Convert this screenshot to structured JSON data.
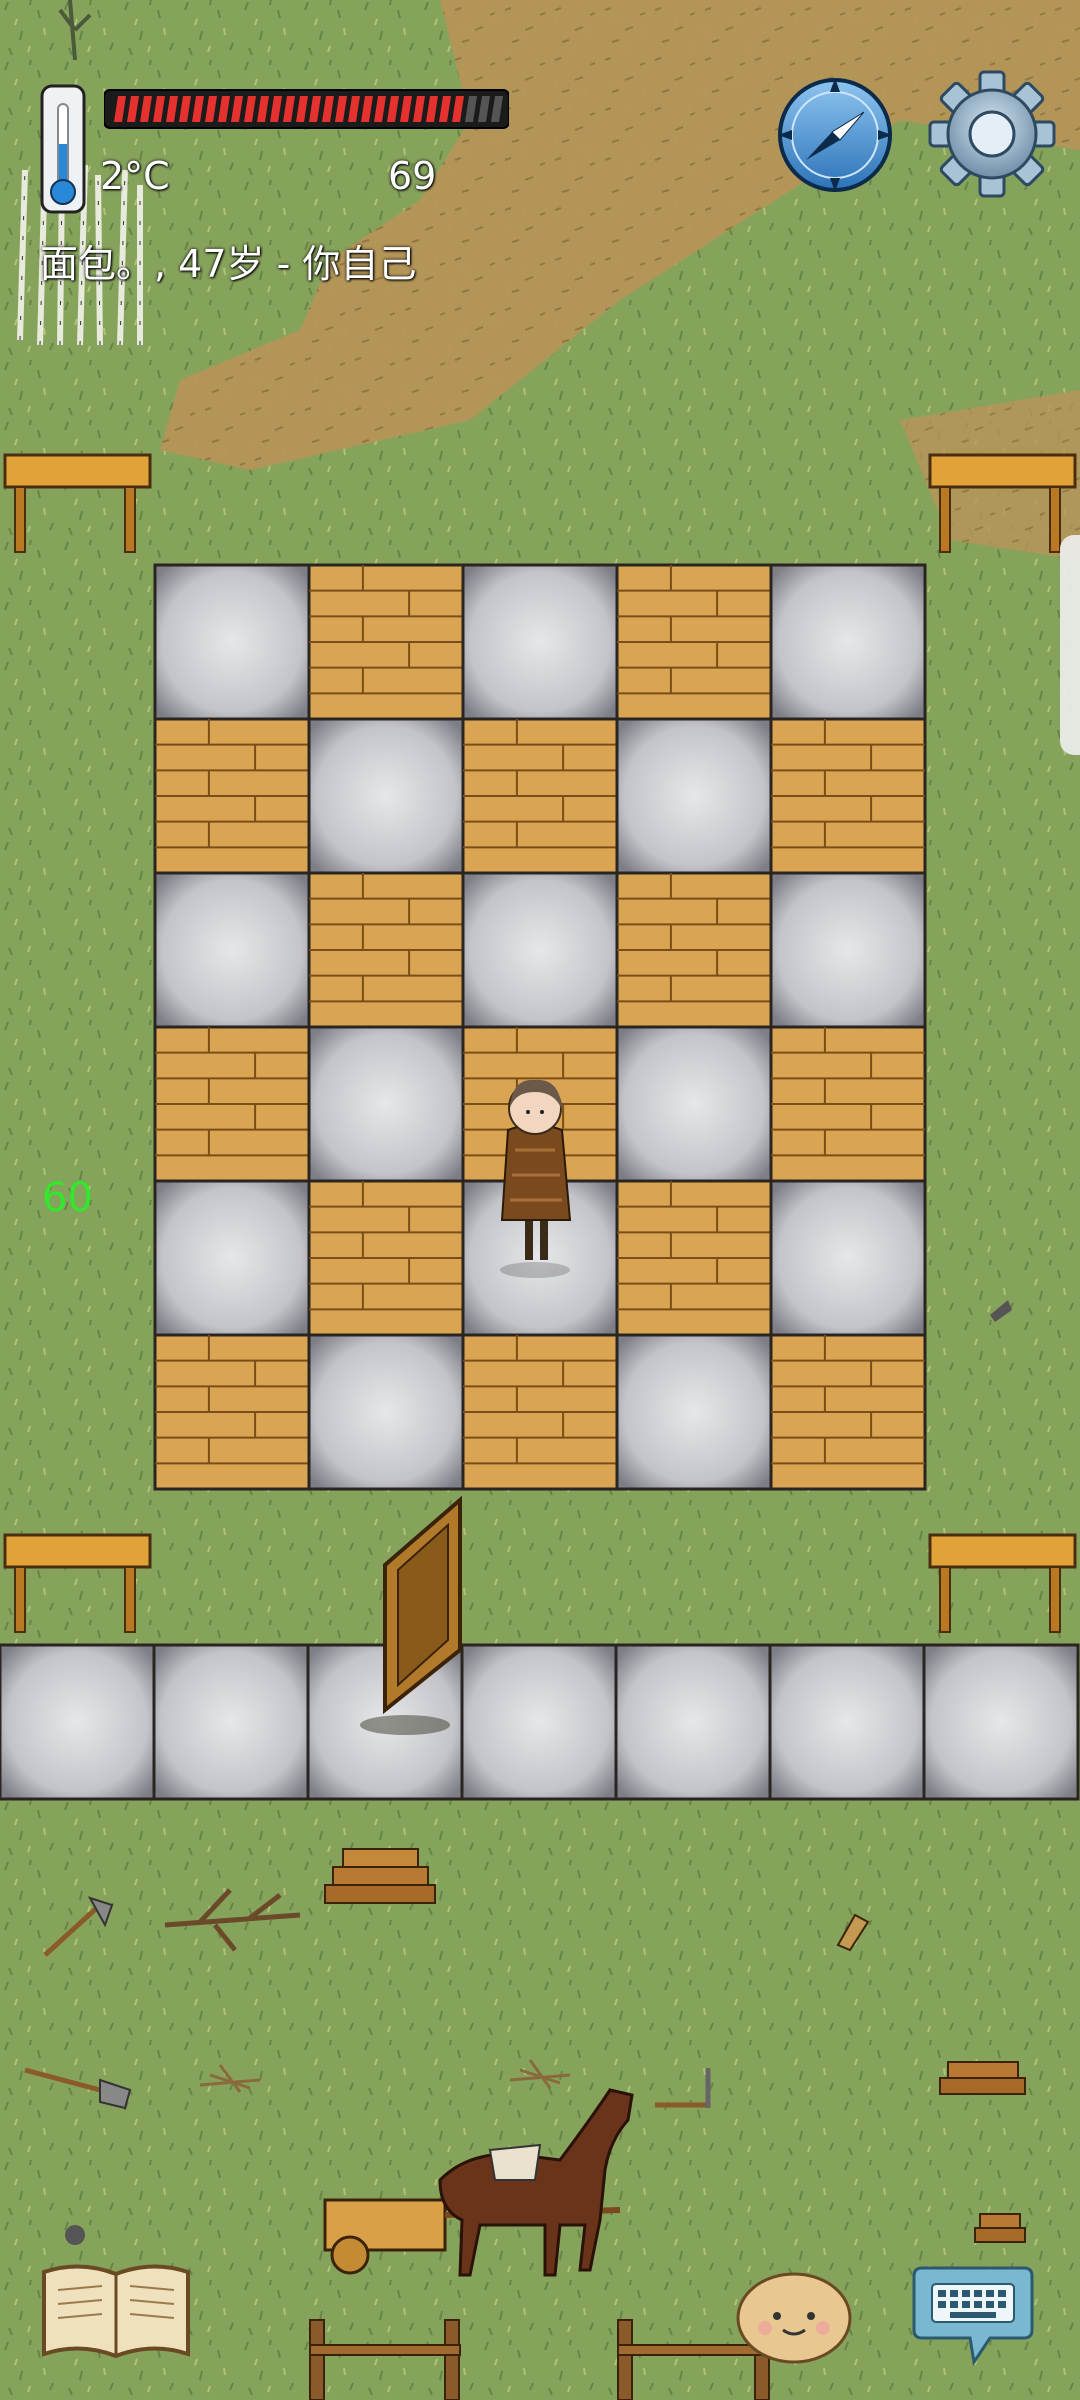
{
  "hud": {
    "temperature": "2°C",
    "food_value": "69",
    "player_label": "面包。, 47岁 - 你自己",
    "health_level": 0.9,
    "fps": "60"
  },
  "icons": {
    "thermometer": "thermometer-icon",
    "compass": "compass-icon",
    "settings": "gear-icon",
    "journal": "open-book-icon",
    "emote": "potato-face-icon",
    "keyboard": "keyboard-chat-icon"
  },
  "colors": {
    "grass": "#7f9e52",
    "dirt": "#b38e4e",
    "stone_tile": "#c9cace",
    "wood_tile": "#d9a552",
    "health_red": "#e5322f",
    "fps_green": "#31e82c"
  },
  "board": {
    "rows": [
      [
        "stone",
        "wood",
        "stone",
        "wood",
        "stone"
      ],
      [
        "wood",
        "stone",
        "wood",
        "stone",
        "wood"
      ],
      [
        "stone",
        "wood",
        "stone",
        "wood",
        "stone"
      ],
      [
        "wood",
        "stone",
        "wood",
        "stone",
        "wood"
      ],
      [
        "stone",
        "wood",
        "stone",
        "wood",
        "stone"
      ],
      [
        "wood",
        "stone",
        "wood",
        "stone",
        "wood"
      ]
    ],
    "path_tiles": 7
  }
}
